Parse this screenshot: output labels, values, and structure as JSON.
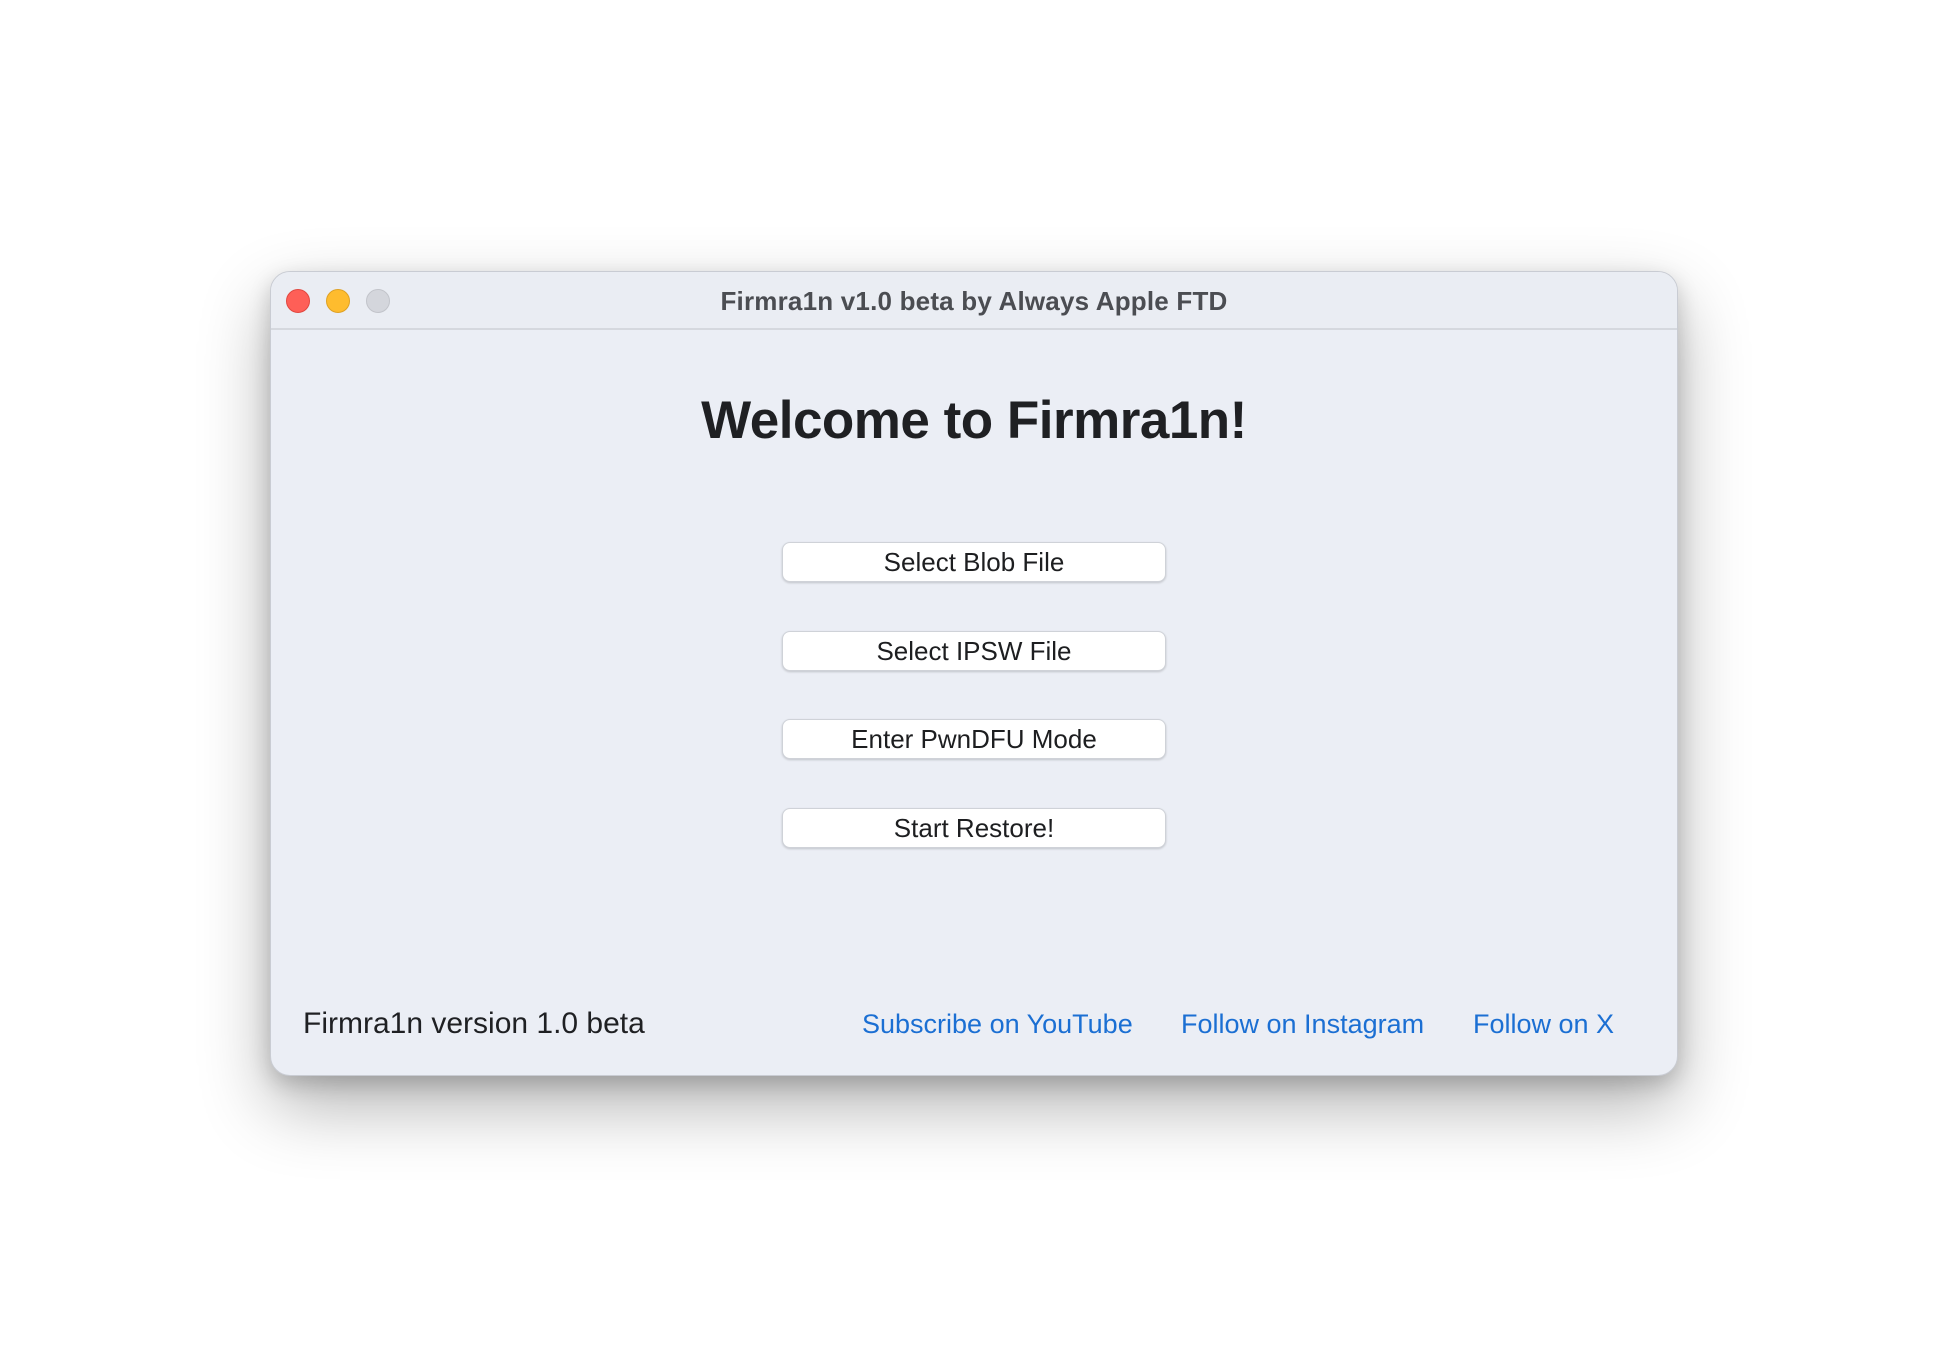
{
  "window": {
    "title": "Firmra1n v1.0 beta by Always Apple FTD"
  },
  "main": {
    "welcome": "Welcome to Firmra1n!",
    "buttons": [
      {
        "label": "Select Blob File"
      },
      {
        "label": "Select IPSW File"
      },
      {
        "label": "Enter PwnDFU Mode"
      },
      {
        "label": "Start Restore!"
      }
    ]
  },
  "footer": {
    "version": "Firmra1n version 1.0 beta",
    "links": [
      {
        "label": "Subscribe on YouTube"
      },
      {
        "label": "Follow on Instagram"
      },
      {
        "label": "Follow on X"
      }
    ]
  },
  "colors": {
    "link": "#1b6fd3",
    "close": "#fe5f57",
    "minimize": "#febc2e",
    "zoom_inactive": "#d4d6dc",
    "window_bg": "#ebeef5"
  }
}
